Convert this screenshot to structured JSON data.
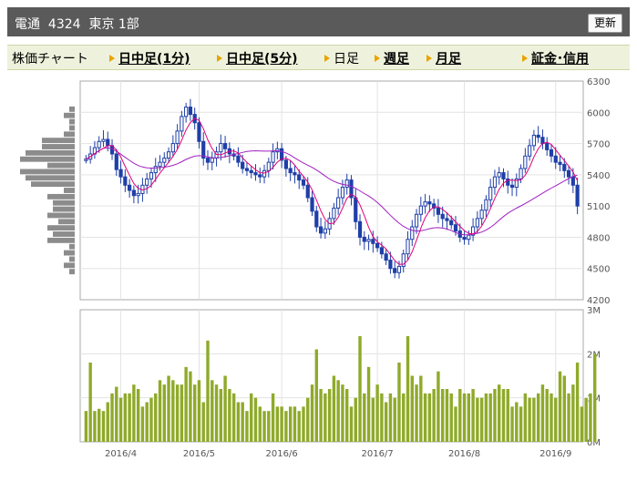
{
  "header": {
    "company": "電通",
    "code": "4324",
    "market": "東京 1部",
    "refresh_label": "更新"
  },
  "tabs": [
    {
      "label": "株価チャート",
      "link": false,
      "arrow": false
    },
    {
      "label": "日中足(1分)",
      "link": true,
      "arrow": true
    },
    {
      "label": "日中足(5分)",
      "link": true,
      "arrow": true
    },
    {
      "label": "日足",
      "link": false,
      "arrow": true
    },
    {
      "label": "週足",
      "link": true,
      "arrow": true
    },
    {
      "label": "月足",
      "link": true,
      "arrow": true
    },
    {
      "label": "証金･信用",
      "link": true,
      "arrow": true
    }
  ],
  "colors": {
    "candle": "#1f3fa8",
    "ma_short": "#e0007a",
    "ma_long": "#a020c0",
    "volume": "#8faa2a",
    "price_profile": "#8c8c8c"
  },
  "chart_data": {
    "type": "candlestick",
    "y_price": {
      "min": 4200,
      "max": 6300,
      "ticks": [
        "6300",
        "6000",
        "5700",
        "5400",
        "5100",
        "4800",
        "4500",
        "4200"
      ]
    },
    "y_volume": {
      "min": 0,
      "max": 3000000,
      "ticks": [
        "3M",
        "2M",
        "1M",
        "0M"
      ]
    },
    "x_labels": [
      "2016/4",
      "2016/5",
      "2016/6",
      "2016/7",
      "2016/8",
      "2016/9"
    ],
    "x_label_index": [
      8,
      26,
      45,
      67,
      87,
      108
    ],
    "close": [
      5550,
      5600,
      5660,
      5720,
      5740,
      5680,
      5600,
      5450,
      5380,
      5300,
      5250,
      5200,
      5220,
      5300,
      5360,
      5420,
      5480,
      5520,
      5560,
      5620,
      5700,
      5820,
      5960,
      6050,
      5980,
      5900,
      5720,
      5560,
      5520,
      5560,
      5620,
      5700,
      5650,
      5600,
      5580,
      5520,
      5460,
      5440,
      5420,
      5400,
      5380,
      5440,
      5520,
      5620,
      5650,
      5540,
      5460,
      5420,
      5400,
      5350,
      5300,
      5180,
      5050,
      4900,
      4840,
      4880,
      4980,
      5080,
      5180,
      5280,
      5350,
      5180,
      4950,
      4800,
      4760,
      4780,
      4740,
      4700,
      4640,
      4580,
      4500,
      4460,
      4520,
      4640,
      4780,
      4900,
      5020,
      5100,
      5140,
      5120,
      5080,
      5020,
      4980,
      4960,
      4920,
      4860,
      4800,
      4780,
      4820,
      4900,
      4980,
      5060,
      5160,
      5280,
      5380,
      5420,
      5360,
      5300,
      5280,
      5360,
      5460,
      5580,
      5680,
      5780,
      5760,
      5700,
      5640,
      5580,
      5520,
      5500,
      5440,
      5380,
      5300,
      5100
    ],
    "volume": [
      700000,
      1800000,
      700000,
      750000,
      700000,
      900000,
      1100000,
      1250000,
      1000000,
      1100000,
      1100000,
      1300000,
      1200000,
      800000,
      900000,
      1000000,
      1100000,
      1400000,
      1300000,
      1500000,
      1400000,
      1300000,
      1300000,
      1700000,
      1600000,
      1300000,
      1400000,
      900000,
      2300000,
      1400000,
      1300000,
      1200000,
      1500000,
      1200000,
      1100000,
      900000,
      900000,
      700000,
      1100000,
      1000000,
      800000,
      700000,
      700000,
      1100000,
      800000,
      800000,
      700000,
      800000,
      800000,
      700000,
      800000,
      1000000,
      1300000,
      2100000,
      1200000,
      1100000,
      1200000,
      1500000,
      1400000,
      1300000,
      1200000,
      800000,
      1000000,
      2400000,
      1100000,
      1700000,
      1000000,
      1300000,
      1100000,
      900000,
      1100000,
      1000000,
      1800000,
      1100000,
      2400000,
      1500000,
      1300000,
      1500000,
      1100000,
      1100000,
      1200000,
      1600000,
      1200000,
      1200000,
      1100000,
      800000,
      1200000,
      1100000,
      1100000,
      1200000,
      1000000,
      1000000,
      1100000,
      1100000,
      1200000,
      1300000,
      1200000,
      1200000,
      800000,
      900000,
      800000,
      1100000,
      1000000,
      1000000,
      1100000,
      1300000,
      1200000,
      1100000,
      1000000,
      1600000,
      1500000,
      1100000,
      1300000,
      1800000,
      800000,
      1000000,
      1100000,
      2000000
    ]
  }
}
